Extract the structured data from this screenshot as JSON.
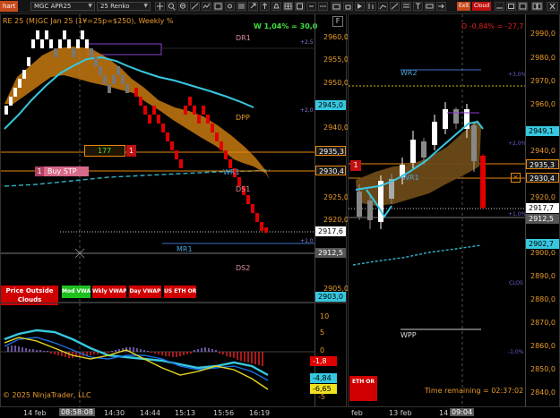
{
  "toolbar": {
    "chart_tab": "hart",
    "instrument": "MGC APR25",
    "bar_type": "25 Renko",
    "badge_a": "Exit",
    "badge_b": "Cloud"
  },
  "left_chart": {
    "header": "RE 25 (M)GC Jan 25 (1¥=25p=$250), Weekly %",
    "panel_f": "F",
    "gain_label": "W 1,04% = 30,0",
    "levels": {
      "dr1": "DR1",
      "dpp": "DPP",
      "wr1": "WR1",
      "ds1": "DS1",
      "mr1": "MR1",
      "ds2": "DS2"
    },
    "y_ticks": [
      "2960,0",
      "2955,0",
      "2950,0",
      "2945,0",
      "2940,0",
      "2935,0",
      "2930,0",
      "2925,0",
      "2920,0",
      "2915,0",
      "2910,0",
      "2905,0"
    ],
    "price_tags": {
      "p2945": "2945,0",
      "p2935": "2935,3",
      "p2930": "2930,4",
      "p2917": "2917,6",
      "p2912": "2912,5",
      "p2903": "2903,0"
    },
    "right_small_labels": {
      "a": "+2,5",
      "b": "+2,0",
      "c": "+1,0"
    },
    "order_qty": "177",
    "order_count": "1",
    "buy_stop_count": "1",
    "buy_stop_label": "Buy STP",
    "close_x": "✕",
    "buttons": {
      "price_outside": "Price Outside Clouds",
      "mod_vwap": "Mod VWAP",
      "wkly_vwap": "Wkly VWAP",
      "day_vwap": "Day VWAP",
      "us_eth_or": "US ETH OR"
    },
    "osc_ticks": [
      "10",
      "5",
      "0",
      "-5"
    ],
    "osc_tags": {
      "a": "-1,8",
      "b": "-4,84",
      "c": "-6,65"
    },
    "copyright": "© 2025 NinjaTrader, LLC",
    "x_labels": [
      "14 feb",
      "08:58:08",
      "14:30",
      "14:44",
      "15:13",
      "15:56",
      "16:19"
    ]
  },
  "right_chart": {
    "gain_label": "D -0,84% = -27,7",
    "levels": {
      "wr2": "WR2",
      "wr1": "WR1",
      "wpp": "WPP",
      "close": "CLOS"
    },
    "y_ticks": [
      "2990,0",
      "2980,0",
      "2970,0",
      "2960,0",
      "2950,0",
      "2940,0",
      "2930,0",
      "2920,0",
      "2910,0",
      "2900,0",
      "2890,0",
      "2880,0",
      "2870,0",
      "2860,0",
      "2850,0",
      "2840,0"
    ],
    "price_tags": {
      "p2949": "2949,1",
      "p2935": "2935,3",
      "p2930": "2930,4",
      "p2917": "2917,7",
      "p2912": "2912,5",
      "p2902": "2902,7"
    },
    "pct_labels": {
      "a": "+3,0%",
      "b": "+2,0%",
      "c": "+1,0%",
      "d": "-1,0%"
    },
    "order_count": "1",
    "close_x": "✕",
    "eth_or": "ETH OR",
    "time_remaining": "Time remaining = 02:37:02",
    "x_labels": [
      "feb",
      "13 feb",
      "14",
      "09:04"
    ]
  },
  "colors": {
    "up_brick": "#ffffff",
    "down_brick": "#e00000",
    "cloud_orange": "#c77a10",
    "cyan": "#37c8e0",
    "tag_orange": "#e8870e",
    "axis_orange": "#e89a2a"
  }
}
